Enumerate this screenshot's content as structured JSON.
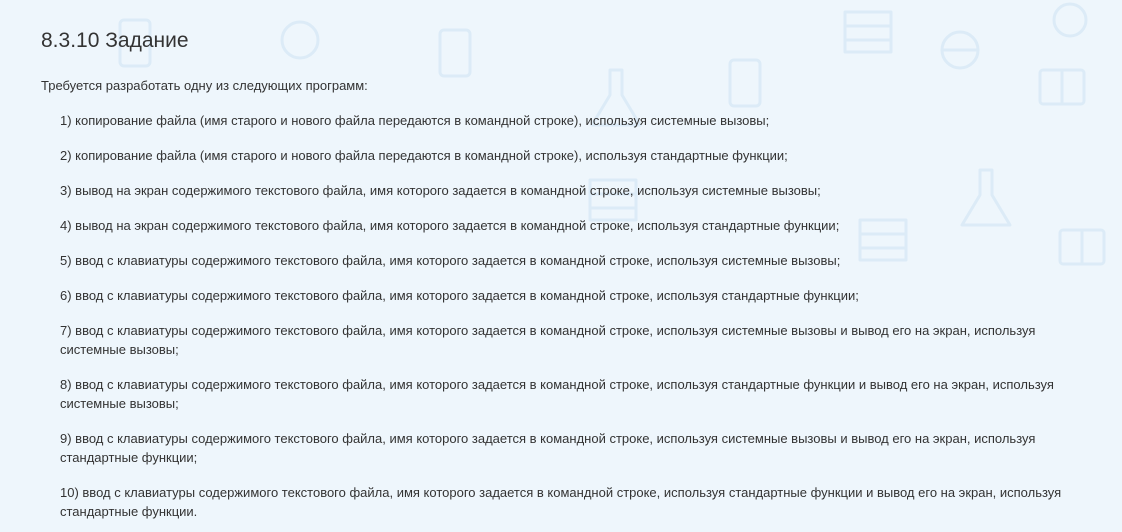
{
  "page": {
    "title": "8.3.10 Задание",
    "intro": "Требуется разработать одну из следующих программ:"
  },
  "tasks": [
    {
      "text": "1) копирование файла (имя старого и нового файла передаются в командной строке), используя системные вызовы;"
    },
    {
      "text": "2) копирование файла (имя старого и нового файла передаются в командной строке), используя стандартные функции;"
    },
    {
      "text": "3) вывод на экран содержимого текстового файла, имя которого задается в командной строке, используя системные вызовы;"
    },
    {
      "text": "4) вывод на экран содержимого текстового файла, имя которого задается в командной строке, используя стандартные функции;"
    },
    {
      "text": "5) ввод с клавиатуры содержимого текстового файла, имя которого задается в командной строке, используя системные вызовы;"
    },
    {
      "text": "6) ввод с клавиатуры содержимого текстового файла, имя которого задается в командной строке, используя стандартные функции;"
    },
    {
      "text": "7) ввод с клавиатуры содержимого текстового файла, имя которого задается в командной строке, используя системные вызовы и вывод его на экран, используя системные вызовы;"
    },
    {
      "text": "8) ввод с клавиатуры содержимого текстового файла, имя которого задается в командной строке, используя стандартные функции и вывод его на экран, используя системные вызовы;"
    },
    {
      "text": "9) ввод с клавиатуры содержимого текстового файла, имя которого задается в командной строке, используя системные вызовы и вывод его на экран, используя стандартные функции;"
    },
    {
      "text": "10) ввод с клавиатуры содержимого текстового файла, имя которого задается в командной строке, используя стандартные функции и вывод его на экран, используя стандартные функции."
    }
  ],
  "colors": {
    "background": "#eef6fc",
    "pattern": "#dcebf7",
    "text": "#333333"
  }
}
